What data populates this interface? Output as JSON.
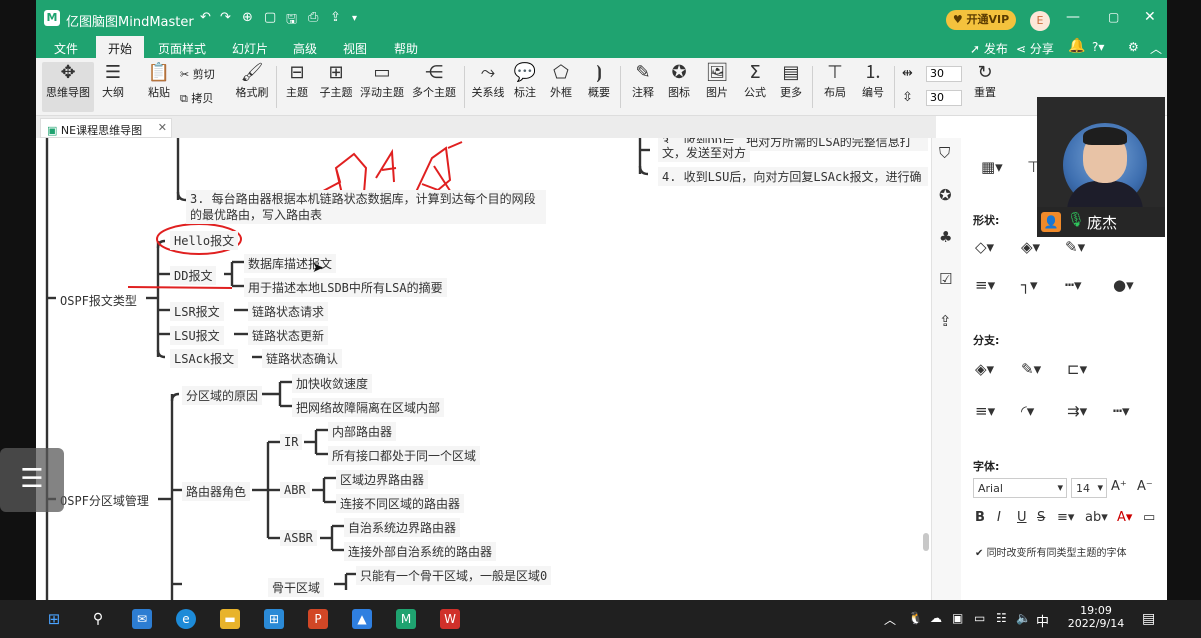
{
  "app": {
    "logo_letter": "M",
    "title": "亿图脑图MindMaster",
    "vip_label": "开通VIP",
    "user_initial": "E"
  },
  "quick_access": [
    "↶",
    "↷",
    "⊕",
    "▢",
    "🖫",
    "⎙",
    "⇪",
    "▾"
  ],
  "menu": {
    "items": [
      "文件",
      "开始",
      "页面样式",
      "幻灯片",
      "高级",
      "视图",
      "帮助"
    ],
    "active": "开始",
    "publish": "发布",
    "share": "分享"
  },
  "ribbon": {
    "mindmap": "思维导图",
    "outline": "大纲",
    "paste": "粘贴",
    "cut": "剪切",
    "copy": "拷贝",
    "format_painter": "格式刷",
    "topic": "主题",
    "subtopic": "子主题",
    "floating": "浮动主题",
    "multi": "多个主题",
    "relation": "关系线",
    "callout": "标注",
    "boundary": "外框",
    "summary": "概要",
    "note": "注释",
    "icon": "图标",
    "picture": "图片",
    "formula": "公式",
    "more": "更多",
    "layout": "布局",
    "numbering": "编号",
    "h_spacing": "30",
    "v_spacing": "30",
    "reset": "重置"
  },
  "doc_tab": {
    "name": "NE课程思维导图",
    "close": "✕"
  },
  "canvas": {
    "top_right_partial": "文，发送至对方",
    "top_right_partial_top": "3. 收到DD后，把对方所需的LSA的完整信息打",
    "step4": "4. 收到LSU后，向对方回复LSAck报文，进行确",
    "step3": "3. 每台路由器根据本机链路状态数据库，计算到达每个目的网段的最优路由，写入路由表",
    "ospf_packet_types": "OSPF报文类型",
    "hello": "Hello报文",
    "dd": "DD报文",
    "dd_child1": "数据库描述报文",
    "dd_child2": "用于描述本地LSDB中所有LSA的摘要",
    "lsr": "LSR报文",
    "lsr_child": "链路状态请求",
    "lsu": "LSU报文",
    "lsu_child": "链路状态更新",
    "lsack": "LSAck报文",
    "lsack_child": "链路状态确认",
    "ospf_area": "OSPF分区域管理",
    "reason": "分区域的原因",
    "reason1": "加快收敛速度",
    "reason2": "把网络故障隔离在区域内部",
    "router_role": "路由器角色",
    "ir": "IR",
    "ir1": "内部路由器",
    "ir2": "所有接口都处于同一个区域",
    "abr": "ABR",
    "abr1": "区域边界路由器",
    "abr2": "连接不同区域的路由器",
    "asbr": "ASBR",
    "asbr1": "自治系统边界路由器",
    "asbr2": "连接外部自治系统的路由器",
    "backbone": "骨干区域",
    "backbone1": "只能有一个骨干区域，一般是区域0"
  },
  "panel": {
    "header_partial": "主",
    "shape": "形状:",
    "branch": "分支:",
    "font": "字体:",
    "font_name": "Arial",
    "font_size": "14",
    "checkbox_label": "同时改变所有同类型主题的字体"
  },
  "cam": {
    "name": "庞杰"
  },
  "taskbar": {
    "time": "19:09",
    "date": "2022/9/14",
    "ime": "中"
  },
  "colors": {
    "brand": "#1fa370",
    "annotation": "#e02020"
  }
}
